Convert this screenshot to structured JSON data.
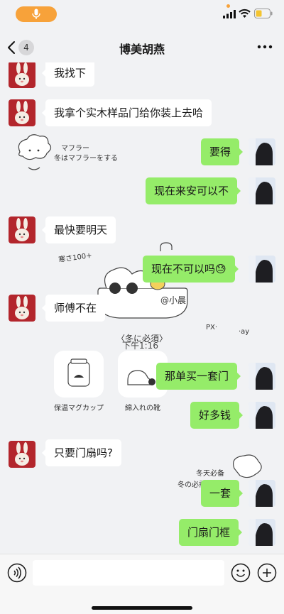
{
  "header": {
    "title": "博美胡燕",
    "unread_count": "4"
  },
  "messages": [
    {
      "side": "left",
      "text": "我找下"
    },
    {
      "side": "left",
      "text": "我拿个实木样品门给你装上去哈"
    },
    {
      "side": "right",
      "text": "要得"
    },
    {
      "side": "right",
      "text": "现在来安可以不"
    },
    {
      "side": "left",
      "text": "最快要明天"
    },
    {
      "side": "right",
      "text": "现在不可以吗😓"
    },
    {
      "side": "left",
      "text": "师傅不在"
    },
    {
      "side": "right",
      "text": "那单买一套门"
    },
    {
      "side": "right",
      "text": "好多钱"
    },
    {
      "side": "left",
      "text": "只要门扇吗?"
    },
    {
      "side": "right",
      "text": "一套"
    },
    {
      "side": "right",
      "text": "门扇门框"
    }
  ],
  "timestamp": "下午1:16",
  "wallpaper": {
    "label_muffler": "マフラー",
    "label_muffler_sub": "冬はマフラーをする",
    "label_cold": "寒さ100+",
    "label_at": "@小晨",
    "label_winter": "〈冬に必須〉",
    "label_mug": "保温マグカップ",
    "label_boots": "綿入れの靴",
    "label_winter_cn": "冬天必备",
    "label_winter_cn2": "冬の必需品",
    "label_px": "PX·",
    "label_ay": "·ay"
  },
  "colors": {
    "sent_bubble": "#95ec69",
    "received_bubble": "#ffffff",
    "background": "#f1f2f4",
    "mic_pill": "#f7a23a"
  }
}
